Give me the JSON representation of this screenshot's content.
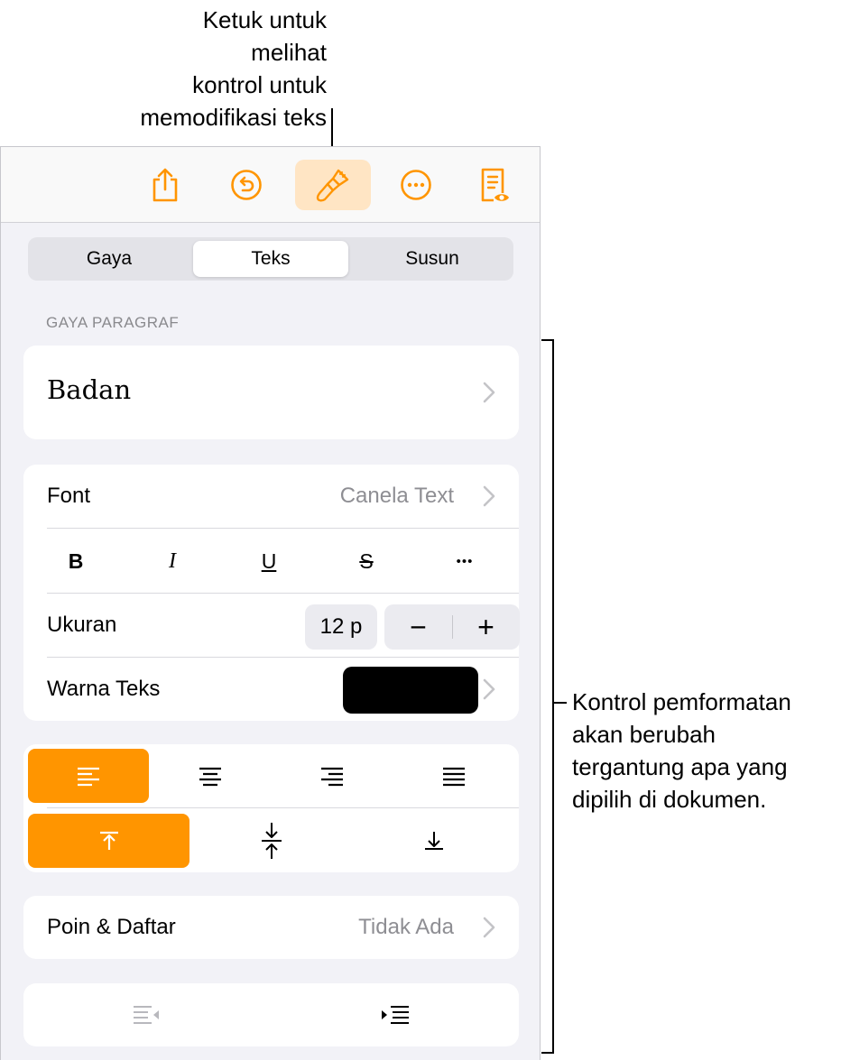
{
  "callouts": {
    "top_lines": [
      "Ketuk untuk",
      "melihat",
      "kontrol untuk",
      "memodifikasi teks"
    ],
    "right_lines": [
      "Kontrol pemformatan",
      "akan berubah",
      "tergantung apa yang",
      "dipilih di dokumen."
    ]
  },
  "toolbar": {
    "buttons": [
      {
        "icon": "share-icon",
        "active": false
      },
      {
        "icon": "undo-icon",
        "active": false
      },
      {
        "icon": "paintbrush-icon",
        "active": true
      },
      {
        "icon": "more-icon",
        "active": false
      },
      {
        "icon": "reading-view-icon",
        "active": false
      }
    ],
    "accent": "#ff9500"
  },
  "tabs": [
    {
      "label": "Gaya",
      "selected": false
    },
    {
      "label": "Teks",
      "selected": true
    },
    {
      "label": "Susun",
      "selected": false
    }
  ],
  "paragraph_style": {
    "header": "GAYA PARAGRAF",
    "value": "Badan"
  },
  "font": {
    "label": "Font",
    "value": "Canela Text",
    "styles": [
      "B",
      "I",
      "U",
      "S",
      "•••"
    ]
  },
  "size": {
    "label": "Ukuran",
    "value": "12 p",
    "decrement": "−",
    "increment": "+"
  },
  "text_color": {
    "label": "Warna Teks",
    "color": "#000000"
  },
  "alignment": {
    "horizontal": [
      "align-left-icon",
      "align-center-icon",
      "align-right-icon",
      "justify-icon"
    ],
    "horizontal_selected": 0,
    "vertical": [
      "align-top-icon",
      "align-middle-icon",
      "align-bottom-icon"
    ],
    "vertical_selected": 0
  },
  "bullets": {
    "label": "Poin & Daftar",
    "value": "Tidak Ada"
  },
  "indent": {
    "buttons": [
      "decrease-indent-icon",
      "increase-indent-icon"
    ]
  }
}
